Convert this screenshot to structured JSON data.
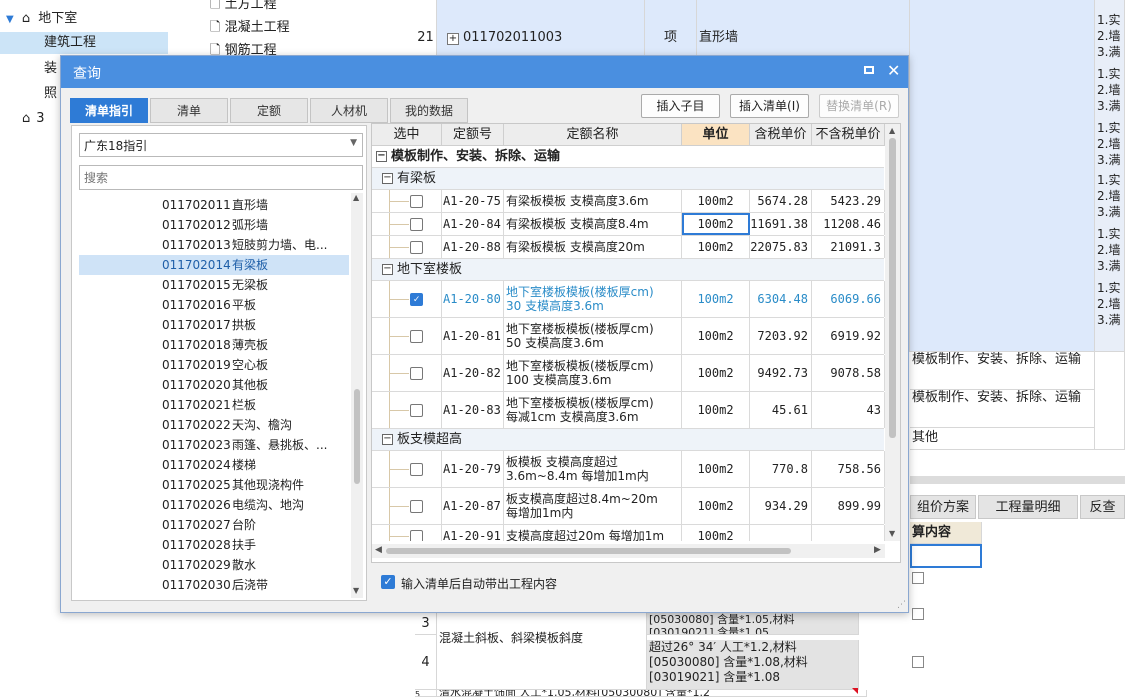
{
  "bg_tree": {
    "items": [
      {
        "label": "地下室"
      },
      {
        "label": "建筑工程"
      },
      {
        "label": "装"
      },
      {
        "label": "照"
      },
      {
        "label": "3"
      }
    ]
  },
  "bg_files": [
    "土方工程",
    "混凝土工程",
    "钢筋工程"
  ],
  "bg_grid": {
    "row21": {
      "num": "21",
      "code": "011702011003",
      "unit": "项",
      "name": "直形墙"
    },
    "notes": [
      "1.实",
      "2.墙",
      "3.满"
    ],
    "mid_rows": [
      "模板制作、安装、拆除、运输",
      "模板制作、安装、拆除、运输",
      "其他"
    ],
    "tabs": [
      "组价方案",
      "工程量明细",
      "反查"
    ],
    "col_header": "算内容",
    "bottom_rows": [
      {
        "num": "3",
        "text": "[05030080] 含量*1.05,材料\n[03019021] 含量*1.05"
      },
      {
        "num": "4",
        "name": "混凝土斜板、斜梁模板斜度",
        "text": "超过26° 34′ 人工*1.2,材料\n[05030080] 含量*1.08,材料\n[03019021] 含量*1.08"
      },
      {
        "num": "5",
        "text": "清水混凝土饰面 人工*1.05,材料[05030080] 含量*1.2"
      }
    ]
  },
  "dialog": {
    "title": "查询",
    "tabs": [
      "清单指引",
      "清单",
      "定额",
      "人材机",
      "我的数据"
    ],
    "buttons": {
      "insert_child": "插入子目",
      "insert_list": "插入清单(I)",
      "replace_list": "替换清单(R)"
    },
    "region_select": "广东18指引",
    "search_placeholder": "搜索",
    "list_items": [
      {
        "code": "011702011",
        "name": "直形墙"
      },
      {
        "code": "011702012",
        "name": "弧形墙"
      },
      {
        "code": "011702013",
        "name": "短肢剪力墙、电..."
      },
      {
        "code": "011702014",
        "name": "有梁板"
      },
      {
        "code": "011702015",
        "name": "无梁板"
      },
      {
        "code": "011702016",
        "name": "平板"
      },
      {
        "code": "011702017",
        "name": "拱板"
      },
      {
        "code": "011702018",
        "name": "薄壳板"
      },
      {
        "code": "011702019",
        "name": "空心板"
      },
      {
        "code": "011702020",
        "name": "其他板"
      },
      {
        "code": "011702021",
        "name": "栏板"
      },
      {
        "code": "011702022",
        "name": "天沟、檐沟"
      },
      {
        "code": "011702023",
        "name": "雨篷、悬挑板、..."
      },
      {
        "code": "011702024",
        "name": "楼梯"
      },
      {
        "code": "011702025",
        "name": "其他现浇构件"
      },
      {
        "code": "011702026",
        "name": "电缆沟、地沟"
      },
      {
        "code": "011702027",
        "name": "台阶"
      },
      {
        "code": "011702028",
        "name": "扶手"
      },
      {
        "code": "011702029",
        "name": "散水"
      },
      {
        "code": "011702030",
        "name": "后浇带"
      }
    ],
    "table": {
      "headers": [
        "选中",
        "定额号",
        "定额名称",
        "单位",
        "含税单价",
        "不含税单价"
      ],
      "top_group": "模板制作、安装、拆除、运输",
      "groups": [
        {
          "name": "有梁板",
          "rows": [
            {
              "code": "A1-20-75",
              "name": "有梁板模板 支模高度3.6m",
              "unit": "100m2",
              "price_tax": "5674.28",
              "price_notax": "5423.29",
              "checked": false
            },
            {
              "code": "A1-20-84",
              "name": "有梁板模板 支模高度8.4m",
              "unit": "100m2",
              "price_tax": "11691.38",
              "price_notax": "11208.46",
              "checked": false
            },
            {
              "code": "A1-20-88",
              "name": "有梁板模板 支模高度20m",
              "unit": "100m2",
              "price_tax": "22075.83",
              "price_notax": "21091.3",
              "checked": false
            }
          ]
        },
        {
          "name": "地下室楼板",
          "rows": [
            {
              "code": "A1-20-80",
              "name": "地下室楼板模板(楼板厚cm)\n30 支模高度3.6m",
              "unit": "100m2",
              "price_tax": "6304.48",
              "price_notax": "6069.66",
              "checked": true
            },
            {
              "code": "A1-20-81",
              "name": "地下室楼板模板(楼板厚cm)\n50 支模高度3.6m",
              "unit": "100m2",
              "price_tax": "7203.92",
              "price_notax": "6919.92",
              "checked": false
            },
            {
              "code": "A1-20-82",
              "name": "地下室楼板模板(楼板厚cm)\n100 支模高度3.6m",
              "unit": "100m2",
              "price_tax": "9492.73",
              "price_notax": "9078.58",
              "checked": false
            },
            {
              "code": "A1-20-83",
              "name": "地下室楼板模板(楼板厚cm)\n每减1cm 支模高度3.6m",
              "unit": "100m2",
              "price_tax": "45.61",
              "price_notax": "43",
              "checked": false
            }
          ]
        },
        {
          "name": "板支模超高",
          "rows": [
            {
              "code": "A1-20-79",
              "name": "板模板 支模高度超过\n3.6m~8.4m 每增加1m内",
              "unit": "100m2",
              "price_tax": "770.8",
              "price_notax": "758.56",
              "checked": false
            },
            {
              "code": "A1-20-87",
              "name": "板支模高度超过8.4m~20m\n每增加1m内",
              "unit": "100m2",
              "price_tax": "934.29",
              "price_notax": "899.99",
              "checked": false
            },
            {
              "code": "A1-20-91",
              "name": "支模高度超过20m 每增加1m",
              "unit": "100m2",
              "price_tax": "",
              "price_notax": "",
              "checked": false
            }
          ]
        }
      ]
    },
    "auto_bring_label": "输入清单后自动带出工程内容"
  },
  "colors": {
    "accent": "#2e7bd6",
    "titlebar": "#4a8fe0",
    "selected_text": "#2a8cc8"
  }
}
